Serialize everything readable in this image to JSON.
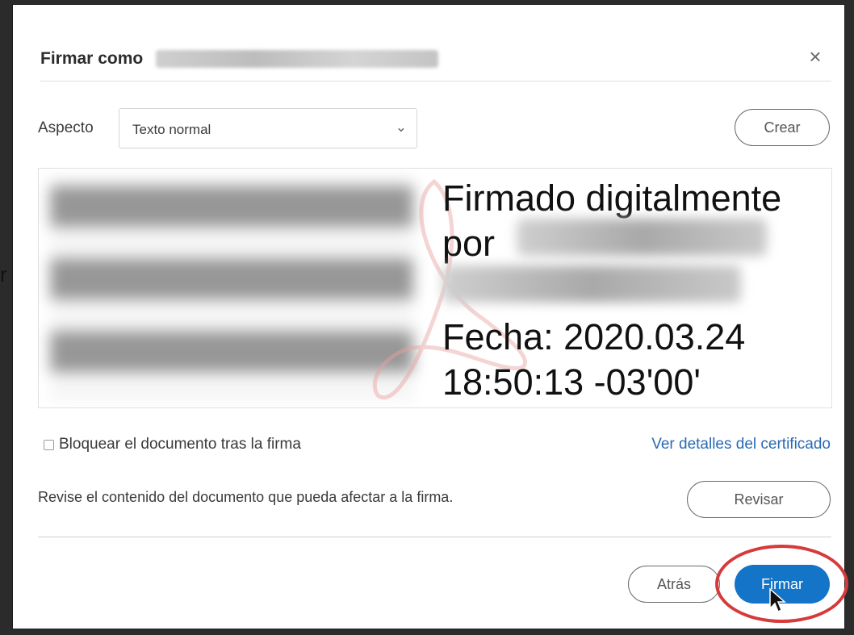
{
  "backdrop": {
    "edge_text": "r"
  },
  "dialog": {
    "title": "Firmar como",
    "close_glyph": "×",
    "aspect": {
      "label": "Aspecto",
      "selected_value": "Texto normal",
      "dropdown_glyph": "⌄"
    },
    "create_label": "Crear",
    "signature_preview": {
      "line1": "Firmado digitalmente",
      "line2": "por",
      "line3": "Fecha: 2020.03.24",
      "line4": "18:50:13 -03'00'"
    },
    "lock_checkbox": {
      "label": "Bloquear el documento tras la firma",
      "checked": false
    },
    "certificate_link": "Ver detalles del certificado",
    "review": {
      "text": "Revise el contenido del documento que pueda afectar a la firma.",
      "button_label": "Revisar"
    },
    "footer": {
      "back_label": "Atrás",
      "sign_label": "Firmar"
    }
  },
  "colors": {
    "primary": "#1474c8",
    "link": "#2a6ab4",
    "highlight": "#d63a3a"
  }
}
